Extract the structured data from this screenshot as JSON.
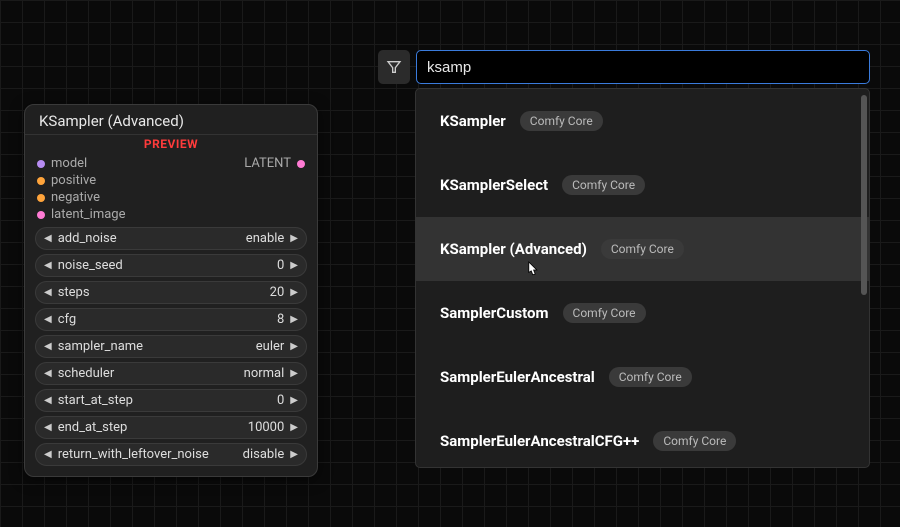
{
  "node": {
    "title": "KSampler (Advanced)",
    "preview_label": "PREVIEW",
    "inputs": [
      {
        "label": "model",
        "color": "#b78cf2"
      },
      {
        "label": "positive",
        "color": "#ffa43b"
      },
      {
        "label": "negative",
        "color": "#ffa43b"
      },
      {
        "label": "latent_image",
        "color": "#ff7bd4"
      }
    ],
    "output": {
      "label": "LATENT",
      "color": "#ff7bd4"
    },
    "widgets": [
      {
        "label": "add_noise",
        "value": "enable"
      },
      {
        "label": "noise_seed",
        "value": "0"
      },
      {
        "label": "steps",
        "value": "20"
      },
      {
        "label": "cfg",
        "value": "8"
      },
      {
        "label": "sampler_name",
        "value": "euler"
      },
      {
        "label": "scheduler",
        "value": "normal"
      },
      {
        "label": "start_at_step",
        "value": "0"
      },
      {
        "label": "end_at_step",
        "value": "10000"
      },
      {
        "label": "return_with_leftover_noise",
        "value": "disable"
      }
    ]
  },
  "search": {
    "query": "ksamp",
    "results": [
      {
        "name": "KSampler",
        "tag": "Comfy Core",
        "hover": false
      },
      {
        "name": "KSamplerSelect",
        "tag": "Comfy Core",
        "hover": false
      },
      {
        "name": "KSampler (Advanced)",
        "tag": "Comfy Core",
        "hover": true
      },
      {
        "name": "SamplerCustom",
        "tag": "Comfy Core",
        "hover": false
      },
      {
        "name": "SamplerEulerAncestral",
        "tag": "Comfy Core",
        "hover": false
      },
      {
        "name": "SamplerEulerAncestralCFG++",
        "tag": "Comfy Core",
        "hover": false
      }
    ]
  }
}
